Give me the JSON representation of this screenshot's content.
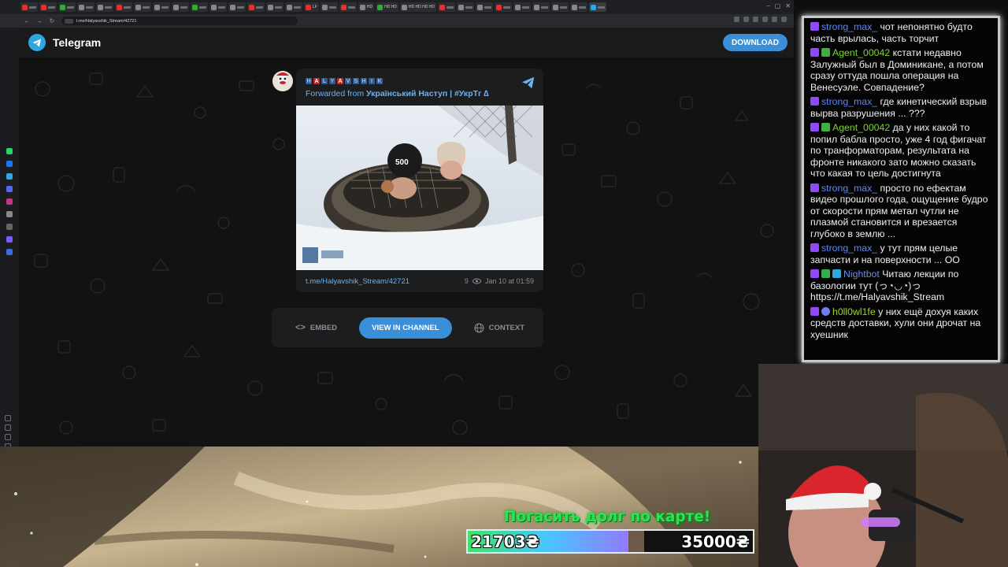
{
  "browser": {
    "url": "t.me/Halyavshik_Stream/42721",
    "tabs": [
      "HD",
      "HD HD",
      "HD HD HD HD",
      "HD",
      "LF"
    ]
  },
  "telegram": {
    "brand": "Telegram",
    "download_label": "DOWNLOAD",
    "author_letters": [
      "H",
      "A",
      "L",
      "Y",
      "A",
      "V",
      "S",
      "H",
      "I",
      "K"
    ],
    "forwarded_prefix": "Forwarded from",
    "forwarded_channel": "Український Наступ | #УкрТг ∆",
    "photo_badge": "500",
    "post_link": "t.me/Halyavshik_Stream/42721",
    "views": "9",
    "date": "Jan 10 at 01:59",
    "embed_label": "EMBED",
    "view_channel_label": "VIEW IN CHANNEL",
    "context_label": "CONTEXT",
    "colors": {
      "accent": "#3a8fd9",
      "link": "#6ab2f2"
    }
  },
  "chat": {
    "messages": [
      {
        "user": "strong_max_",
        "badges": [
          "tw"
        ],
        "text": "чот непонятно будто часть врылась, часть торчит"
      },
      {
        "user": "Agent_00042",
        "badges": [
          "tw",
          "gr"
        ],
        "text": "кстати недавно Залужный был в Доминикане, а потом сразу оттуда пошла операция на Венесуэле. Совпадение?"
      },
      {
        "user": "strong_max_",
        "badges": [
          "tw"
        ],
        "text": "где кинетический взрыв вырва разрушения ... ???"
      },
      {
        "user": "Agent_00042",
        "badges": [
          "tw",
          "gr"
        ],
        "text": "да у них какой то попил бабла просто, уже 4 год фигачат по транформаторам, результата на фронте никакого зато можно сказать что какая то цель достигнута"
      },
      {
        "user": "strong_max_",
        "badges": [
          "tw"
        ],
        "text": "просто по ефектам видео прошлого года, ощущение будро от скорости прям метал чутли не плазмой становится и врезается глубоко в землю ..."
      },
      {
        "user": "strong_max_",
        "badges": [
          "tw"
        ],
        "text": "у тут прям целые запчасти и на поверхности ... ОО"
      },
      {
        "user": "Nightbot",
        "badges": [
          "tw",
          "ck",
          "tl"
        ],
        "text": "Читаю лекции по базологии тут (っ◔◡◔)っ https://t.me/Halyavshik_Stream"
      },
      {
        "user": "h0ll0wl1fe",
        "badges": [
          "tw",
          "gl"
        ],
        "text": "у них ещё дохуя каких средств доставки, хули они дрочат на хуешник"
      }
    ]
  },
  "donation_goal": {
    "title": "Погасить долг по карте!",
    "current": "21703₴",
    "target": "35000₴",
    "progress": 0.62
  }
}
